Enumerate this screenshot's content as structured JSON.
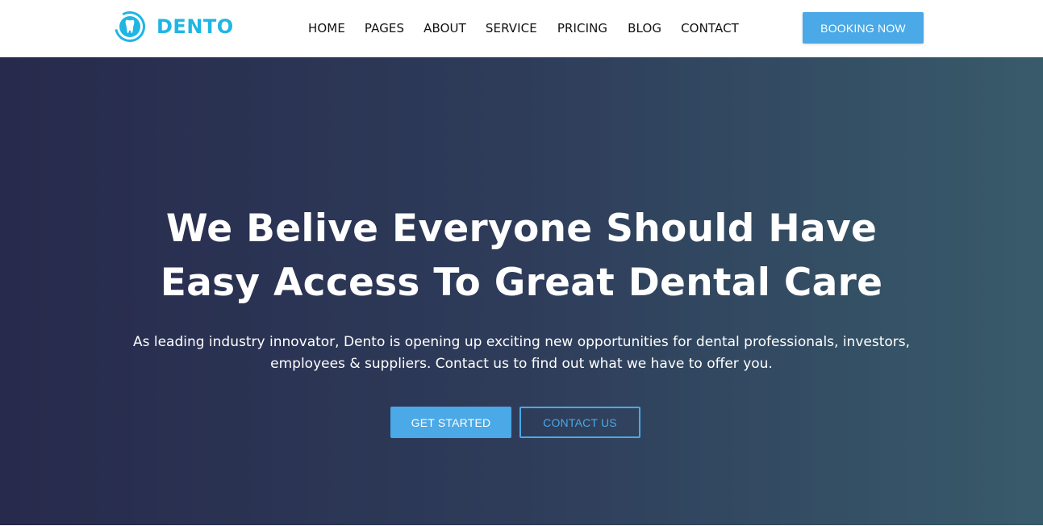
{
  "colors": {
    "brand": "#1fb6e3",
    "accent": "#4aa9e6",
    "hero_gradient_start": "#272a4c",
    "hero_gradient_end": "#385b6b",
    "header_bg": "#ffffff"
  },
  "header": {
    "logo": {
      "icon": "tooth-icon",
      "text": "DENTO"
    },
    "nav": {
      "home": "HOME",
      "pages": "PAGES",
      "about": "ABOUT",
      "service": "SERVICE",
      "pricing": "PRICING",
      "blog": "BLOG",
      "contact": "CONTACT"
    },
    "booking_label": "BOOKING NOW"
  },
  "hero": {
    "title_line1": "We Belive Everyone Should Have",
    "title_line2": "Easy Access To Great Dental Care",
    "description_line1": "As leading industry innovator, Dento is opening up exciting new opportunities for dental professionals, investors,",
    "description_line2": "employees & suppliers. Contact us to find out what we have to offer you.",
    "primary_button": "GET STARTED",
    "secondary_button": "CONTACT US"
  }
}
